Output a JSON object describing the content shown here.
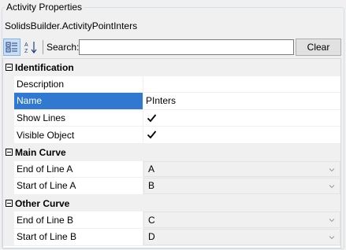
{
  "group": {
    "title": "Activity Properties"
  },
  "object_name": "SolidsBuilder.ActivityPointInters",
  "toolbar": {
    "categorized_icon": "categorized-view-icon",
    "alphabetical_icon": "alphabetical-sort-icon",
    "search_label": "Search:",
    "search_value": "",
    "clear_label": "Clear"
  },
  "categories": [
    {
      "label": "Identification",
      "rows": [
        {
          "name": "Description",
          "value": ""
        },
        {
          "name": "Name",
          "value": "PInters",
          "selected": true
        },
        {
          "name": "Show Lines",
          "checked": true
        },
        {
          "name": "Visible Object",
          "checked": true
        }
      ]
    },
    {
      "label": "Main Curve",
      "rows": [
        {
          "name": "End of Line A",
          "value": "A"
        },
        {
          "name": "Start of Line A",
          "value": "B"
        }
      ]
    },
    {
      "label": "Other Curve",
      "rows": [
        {
          "name": "End of Line B",
          "value": "C"
        },
        {
          "name": "Start of Line B",
          "value": "D"
        }
      ]
    }
  ]
}
